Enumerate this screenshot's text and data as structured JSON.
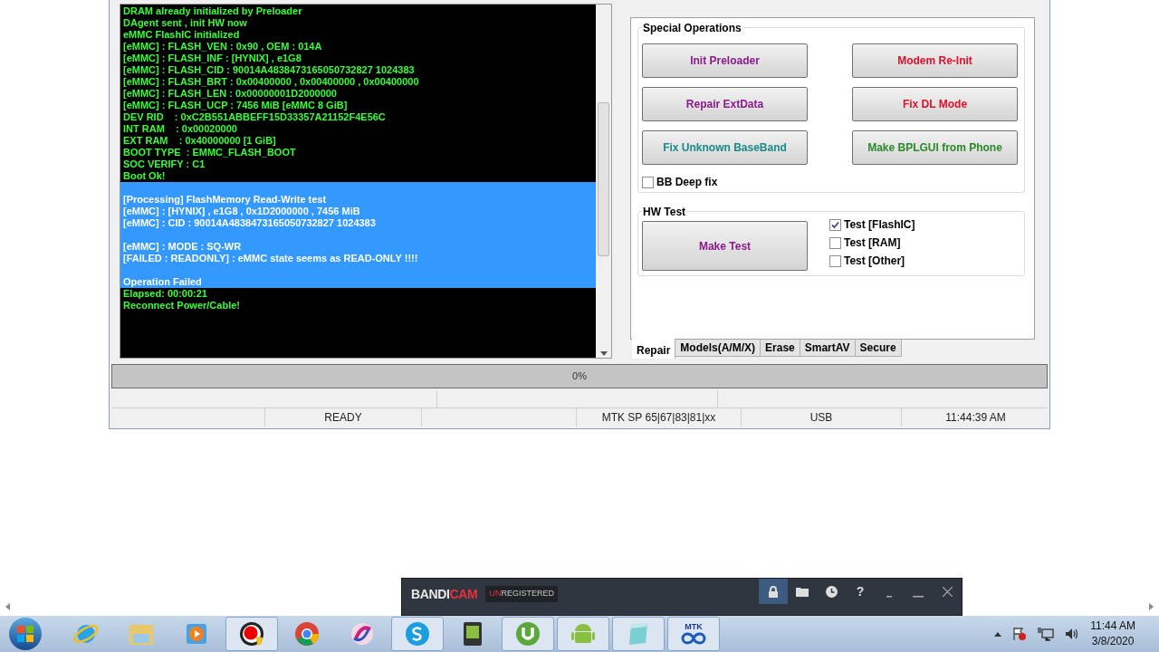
{
  "log": {
    "lines": [
      {
        "text": "DRAM already initialized by Preloader",
        "highlighted": false,
        "blank_before": false
      },
      {
        "text": "DAgent sent , init HW now",
        "highlighted": false,
        "blank_before": false
      },
      {
        "text": "eMMC FlashIC initialized",
        "highlighted": false,
        "blank_before": false
      },
      {
        "text": "[eMMC] : FLASH_VEN : 0x90 , OEM : 014A",
        "highlighted": false,
        "blank_before": false
      },
      {
        "text": "[eMMC] : FLASH_INF : [HYNIX] , e1G8",
        "highlighted": false,
        "blank_before": false
      },
      {
        "text": "[eMMC] : FLASH_CID : 90014A4838473165050732827 1024383",
        "highlighted": false,
        "blank_before": false
      },
      {
        "text": "[eMMC] : FLASH_BRT : 0x00400000 , 0x00400000 , 0x00400000",
        "highlighted": false,
        "blank_before": false
      },
      {
        "text": "[eMMC] : FLASH_LEN : 0x00000001D2000000",
        "highlighted": false,
        "blank_before": false
      },
      {
        "text": "[eMMC] : FLASH_UCP : 7456 MiB [eMMC 8 GiB]",
        "highlighted": false,
        "blank_before": false
      },
      {
        "text": "DEV RID    : 0xC2B551ABBEFF15D33357A21152F4E56C",
        "highlighted": false,
        "blank_before": false
      },
      {
        "text": "INT RAM    : 0x00020000",
        "highlighted": false,
        "blank_before": false
      },
      {
        "text": "EXT RAM    : 0x40000000 [1 GiB]",
        "highlighted": false,
        "blank_before": false
      },
      {
        "text": "BOOT TYPE  : EMMC_FLASH_BOOT",
        "highlighted": false,
        "blank_before": false
      },
      {
        "text": "SOC VERIFY : C1",
        "highlighted": false,
        "blank_before": false
      },
      {
        "text": "Boot Ok!",
        "highlighted": false,
        "blank_before": false
      },
      {
        "text": "[Processing] FlashMemory Read-Write test",
        "highlighted": true,
        "blank_before": true
      },
      {
        "text": "[eMMC] : [HYNIX] , e1G8 , 0x1D2000000 , 7456 MiB",
        "highlighted": true,
        "blank_before": false
      },
      {
        "text": "[eMMC] : CID : 90014A4838473165050732827 1024383",
        "highlighted": true,
        "blank_before": false
      },
      {
        "text": "[eMMC] : MODE : SQ-WR",
        "highlighted": true,
        "blank_before": true
      },
      {
        "text": "[FAILED : READONLY] : eMMC state seems as READ-ONLY !!!!",
        "highlighted": true,
        "blank_before": false
      },
      {
        "text": "Operation Failed",
        "highlighted": true,
        "blank_before": true
      },
      {
        "text": "Elapsed: 00:00:21",
        "highlighted": false,
        "blank_before": false
      },
      {
        "text": "Reconnect Power/Cable!",
        "highlighted": false,
        "blank_before": false
      }
    ]
  },
  "special_operations": {
    "title": "Special Operations",
    "buttons": [
      {
        "label": "Init Preloader",
        "color": "#8b1a8b"
      },
      {
        "label": "Modem Re-Init",
        "color": "#e0102a"
      },
      {
        "label": "Repair ExtData",
        "color": "#8b1a8b"
      },
      {
        "label": "Fix DL Mode",
        "color": "#e0102a"
      },
      {
        "label": "Fix Unknown BaseBand",
        "color": "#1a8a8a"
      },
      {
        "label": "Make BPLGUI from Phone",
        "color": "#2a8a2a"
      }
    ],
    "checkbox": {
      "label": "BB Deep fix",
      "checked": false
    }
  },
  "hw_test": {
    "title": "HW Test",
    "button": "Make Test",
    "checkboxes": [
      {
        "label": "Test [FlashIC]",
        "checked": true
      },
      {
        "label": "Test [RAM]",
        "checked": false
      },
      {
        "label": "Test [Other]",
        "checked": false
      }
    ]
  },
  "bottom_tabs": [
    {
      "label": "Repair",
      "selected": true
    },
    {
      "label": "Models(A/M/X)",
      "selected": false
    },
    {
      "label": "Erase",
      "selected": false
    },
    {
      "label": "SmartAV",
      "selected": false
    },
    {
      "label": "Secure",
      "selected": false
    }
  ],
  "progress": {
    "text": "0%",
    "level": 0
  },
  "status_bar": {
    "state": "READY",
    "protocol": "MTK SP 65|67|83|81|xx",
    "port": "USB",
    "time": "11:44:39 AM"
  },
  "recorder": {
    "logo": [
      "BANDI",
      "CAM"
    ],
    "badge": [
      "UN",
      "REGISTERED"
    ],
    "help": "?"
  },
  "taskbar": {
    "items": [
      {
        "kind": "ie",
        "active": false
      },
      {
        "kind": "folder",
        "active": false
      },
      {
        "kind": "player",
        "active": false
      },
      {
        "kind": "record",
        "active": true
      },
      {
        "kind": "chrome",
        "active": false
      },
      {
        "kind": "swirl",
        "active": false
      },
      {
        "kind": "skype",
        "active": true
      },
      {
        "kind": "phone",
        "active": false
      },
      {
        "kind": "torrent",
        "active": true
      },
      {
        "kind": "android",
        "active": true
      },
      {
        "kind": "notepad",
        "active": true
      },
      {
        "kind": "mtk",
        "active": true,
        "label": "MTK"
      }
    ],
    "time": "11:44 AM",
    "date": "3/8/2020"
  }
}
